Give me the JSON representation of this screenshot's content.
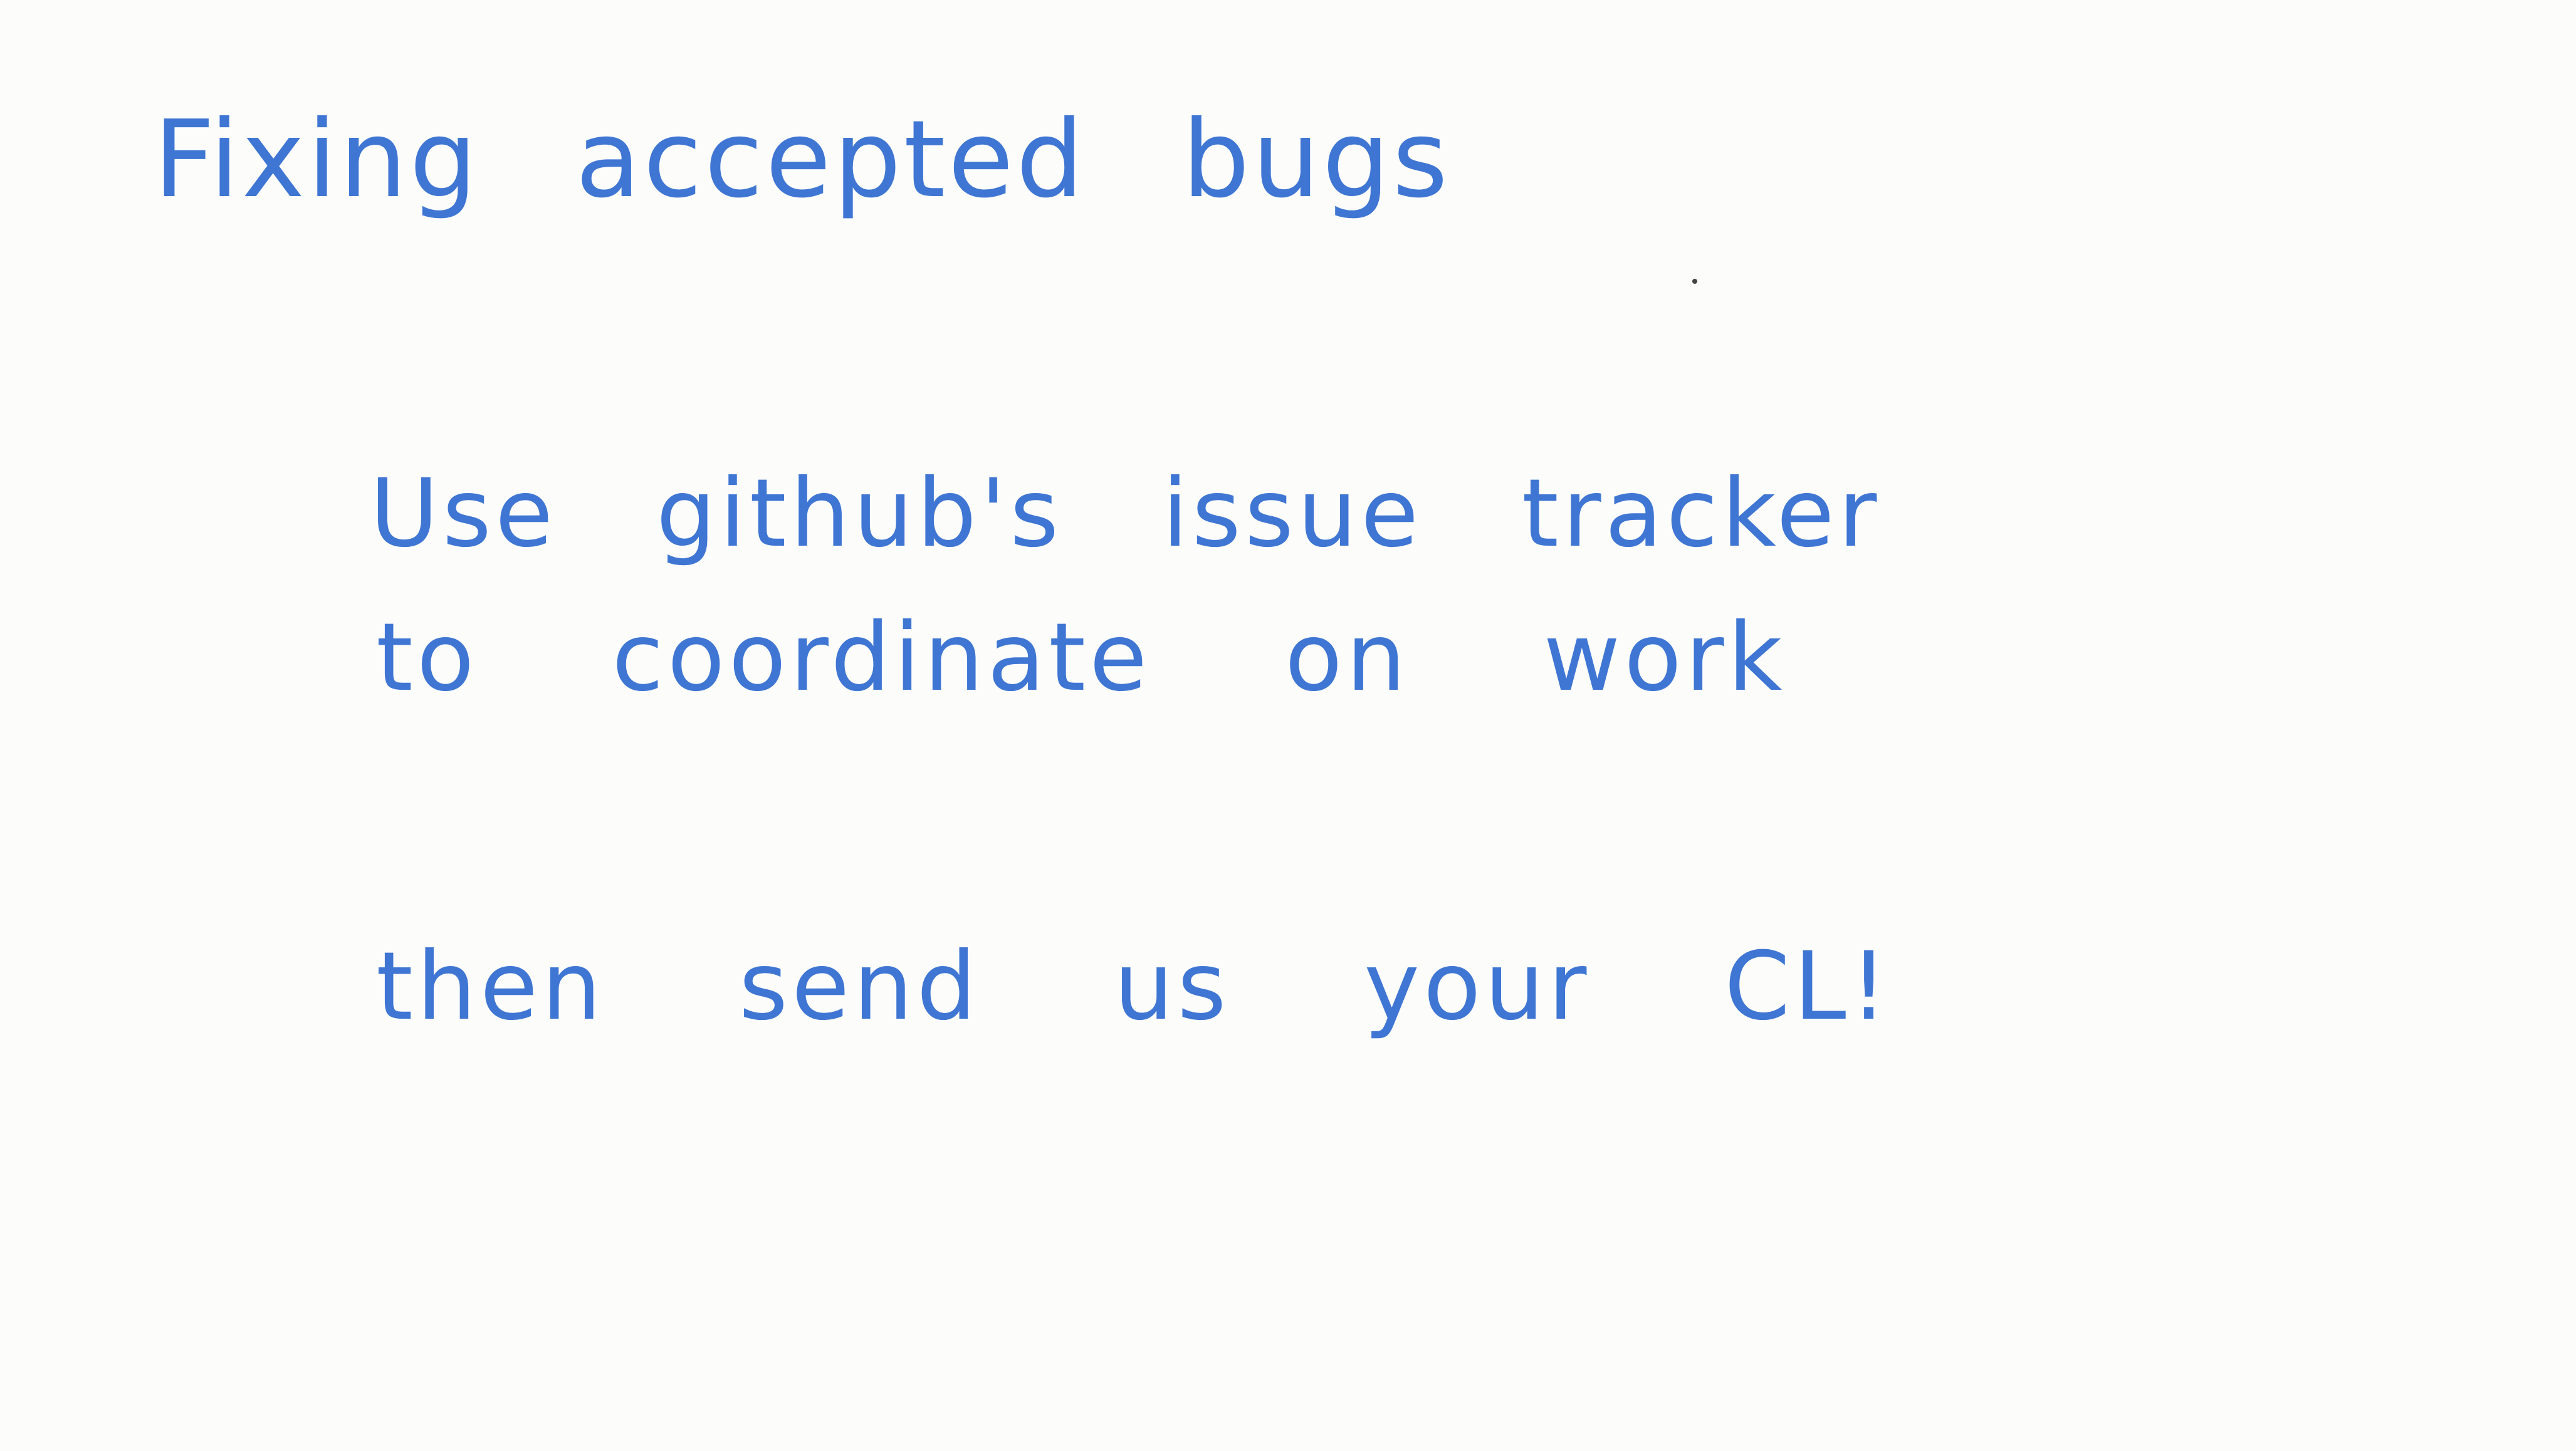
{
  "card": {
    "title": "Fixing accepted bugs",
    "paragraph_lines": [
      "Use github's issue tracker",
      "to coordinate on work"
    ],
    "closing_line": "then send us your CL!"
  },
  "colors": {
    "ink": "#3f76d3",
    "paper": "#fcfcfb"
  }
}
